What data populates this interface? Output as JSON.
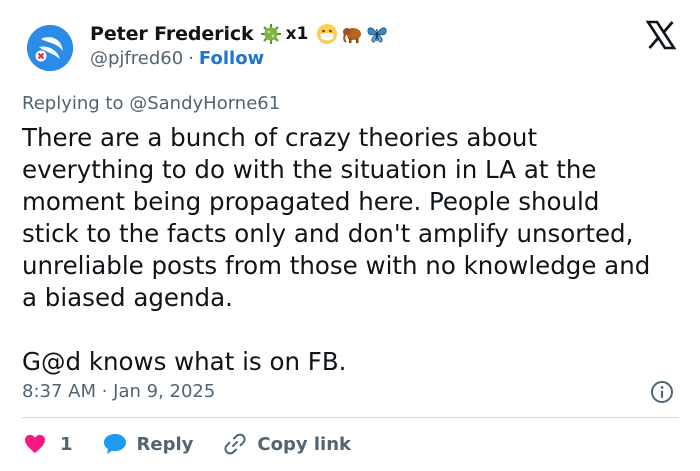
{
  "author": {
    "display_name": "Peter Frederick",
    "badge_count": "x1",
    "handle": "@pjfred60",
    "separator": "·",
    "follow_label": "Follow",
    "avatar_color": "#2b8be8"
  },
  "emojis": [
    "virus-icon",
    "face-with-mask-icon",
    "mammoth-icon",
    "butterfly-icon"
  ],
  "reply": {
    "prefix": "Replying to",
    "mention": "@SandyHorne61"
  },
  "tweet": {
    "text": "There are a bunch of crazy theories about\neverything to do with the situation in LA at the\nmoment being propagated here. People should\nstick to the facts only and don't amplify unsorted,\nunreliable posts from those with no knowledge and\na biased agenda.\n\nG@d knows what is on FB.",
    "timestamp": "8:37 AM · Jan 9, 2025"
  },
  "actions": {
    "like_count": "1",
    "reply_label": "Reply",
    "copy_link_label": "Copy link"
  },
  "colors": {
    "like": "#f91880",
    "reply": "#1d9bf0",
    "follow": "#1d74d3",
    "muted": "#536471"
  }
}
